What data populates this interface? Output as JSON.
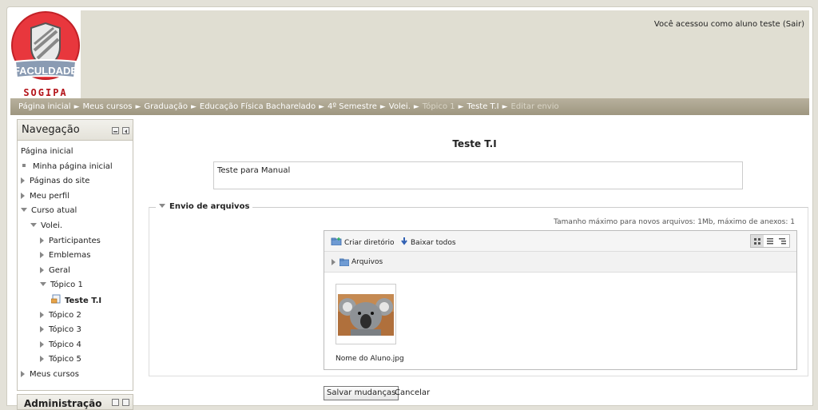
{
  "header": {
    "logo_text": "FACULDADE",
    "logo_subtext": "SOGIPA",
    "login_info": "Você acessou como aluno teste (Sair)"
  },
  "breadcrumb": [
    {
      "label": "Página inicial",
      "dim": false
    },
    {
      "label": "Meus cursos",
      "dim": false
    },
    {
      "label": "Graduação",
      "dim": false
    },
    {
      "label": "Educação Física Bacharelado",
      "dim": false
    },
    {
      "label": "4º Semestre",
      "dim": false
    },
    {
      "label": "Volei.",
      "dim": false
    },
    {
      "label": "Tópico 1",
      "dim": true
    },
    {
      "label": "Teste T.I",
      "dim": false
    },
    {
      "label": "Editar envio",
      "dim": true
    }
  ],
  "navigation": {
    "title": "Navegação",
    "items": [
      {
        "label": "Página inicial",
        "marker": "none",
        "bold": false
      },
      {
        "label": "Minha página inicial",
        "marker": "bullet",
        "bold": false
      },
      {
        "label": "Páginas do site",
        "marker": "collapsed",
        "bold": false
      },
      {
        "label": "Meu perfil",
        "marker": "collapsed",
        "bold": false
      },
      {
        "label": "Curso atual",
        "marker": "expanded",
        "bold": false
      },
      {
        "label": "Volei.",
        "marker": "expanded",
        "bold": false
      },
      {
        "label": "Participantes",
        "marker": "collapsed",
        "bold": false
      },
      {
        "label": "Emblemas",
        "marker": "collapsed",
        "bold": false
      },
      {
        "label": "Geral",
        "marker": "collapsed",
        "bold": false
      },
      {
        "label": "Tópico 1",
        "marker": "expanded",
        "bold": false
      },
      {
        "label": "Teste T.I",
        "marker": "assignment-icon",
        "bold": true
      },
      {
        "label": "Tópico 2",
        "marker": "collapsed",
        "bold": false
      },
      {
        "label": "Tópico 3",
        "marker": "collapsed",
        "bold": false
      },
      {
        "label": "Tópico 4",
        "marker": "collapsed",
        "bold": false
      },
      {
        "label": "Tópico 5",
        "marker": "collapsed",
        "bold": false
      },
      {
        "label": "Meus cursos",
        "marker": "collapsed",
        "bold": false
      }
    ]
  },
  "administration": {
    "title": "Administração"
  },
  "main": {
    "title": "Teste T.I",
    "description": "Teste para Manual",
    "fieldset_legend": "Envio de arquivos",
    "max_size_text": "Tamanho máximo para novos arquivos: 1Mb, máximo de anexos: 1",
    "filemanager": {
      "create_dir_label": "Criar diretório",
      "download_all_label": "Baixar todos",
      "path_label": "Arquivos",
      "file_name": "Nome do Aluno.jpg"
    },
    "save_button": "Salvar mudanças",
    "cancel_link": "Cancelar"
  },
  "colors": {
    "header_bg": "#e0ded2",
    "breadcrumb_bg": "#a39c86",
    "logo_red": "#e8373d",
    "logo_dark": "#b4141a"
  }
}
